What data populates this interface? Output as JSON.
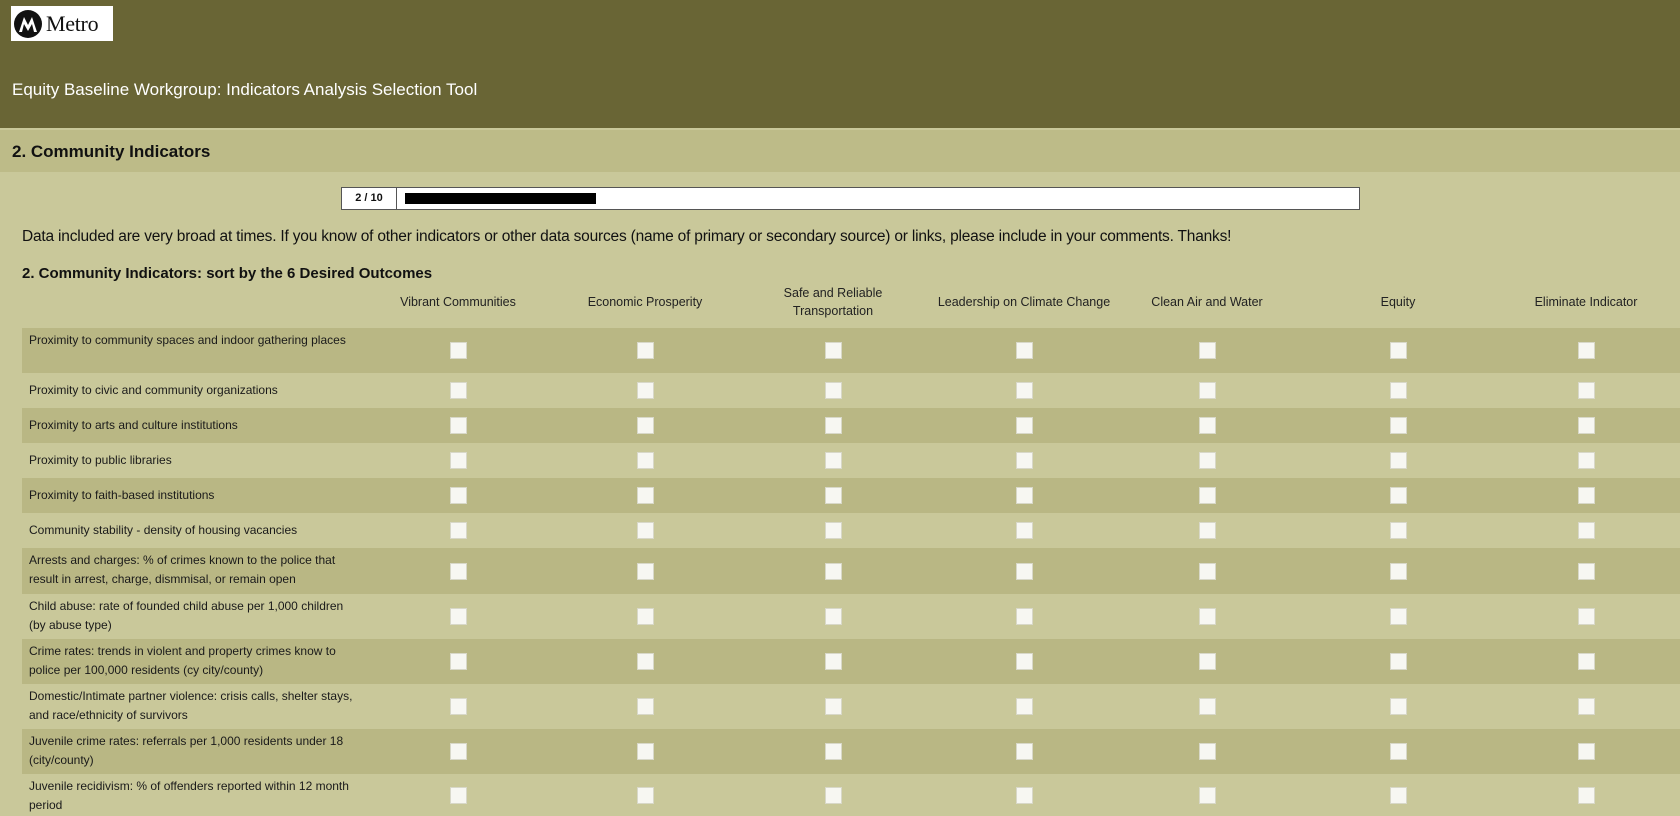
{
  "header": {
    "logo_text": "Metro",
    "title": "Equity Baseline Workgroup:  Indicators Analysis Selection Tool"
  },
  "section": {
    "title": "2. Community Indicators"
  },
  "progress": {
    "label": "2 / 10",
    "fraction": 0.2
  },
  "intro_text": "Data included are very broad at times. If you know of other indicators or other data sources (name of primary or secondary source) or links, please include in your comments. Thanks!",
  "question_title": "2. Community Indicators: sort by the 6 Desired Outcomes",
  "columns": [
    "Vibrant Communities",
    "Economic Prosperity",
    "Safe and Reliable Transportation",
    "Leadership on Climate Change",
    "Clean Air and Water",
    "Equity",
    "Eliminate Indicator"
  ],
  "rows": [
    "Proximity to community spaces and indoor gathering places",
    "Proximity to civic and community organizations",
    "Proximity to arts and culture institutions",
    "Proximity to public libraries",
    "Proximity to faith-based institutions",
    "Community stability - density of housing vacancies",
    "Arrests and charges: % of crimes known to the police that result in arrest, charge, dismmisal, or remain open",
    "Child abuse: rate of founded child abuse per 1,000 children (by abuse type)",
    "Crime rates: trends in violent and property crimes know to police per 100,000 residents (cy city/county)",
    "Domestic/Intimate partner violence: crisis calls, shelter stays, and race/ethnicity of survivors",
    "Juvenile crime rates: referrals per 1,000 residents under 18 (city/county)",
    "Juvenile recidivism: % of offenders reported within 12 month period"
  ],
  "colors": {
    "header_bg": "#696535",
    "section_bg": "#bdbb88",
    "page_bg": "#c9c89a",
    "alt_row_bg": "#b9b784"
  },
  "icons": {
    "logo": "metro-logo-icon",
    "checkbox": "checkbox-unchecked-icon"
  }
}
